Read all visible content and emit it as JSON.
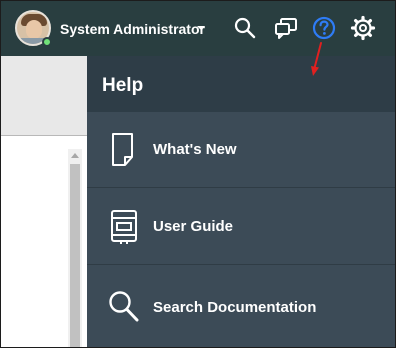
{
  "header": {
    "user_name": "System Administrator",
    "presence_status_color": "#71e279",
    "icons": [
      "search-icon",
      "chat-icon",
      "help-icon",
      "gear-icon"
    ],
    "help_icon_color": "#2e7cf6",
    "background_color": "#293e40"
  },
  "help_panel": {
    "title": "Help",
    "items": [
      {
        "label": "What's New",
        "icon": "document-icon"
      },
      {
        "label": "User Guide",
        "icon": "book-icon"
      },
      {
        "label": "Search Documentation",
        "icon": "search-icon"
      }
    ]
  },
  "annotation": {
    "arrow_color": "#e02020"
  }
}
